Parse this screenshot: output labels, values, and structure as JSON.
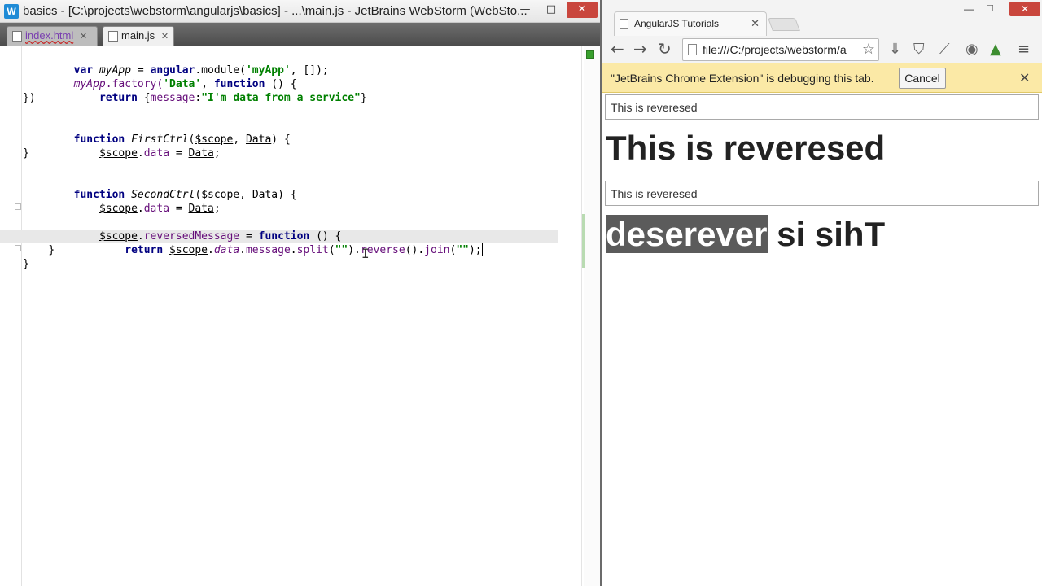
{
  "ide": {
    "title": "basics - [C:\\projects\\webstorm\\angularjs\\basics] - ...\\main.js - JetBrains WebStorm (WebSto...",
    "app_icon": "W",
    "window_controls": {
      "minimize": "—",
      "maximize": "□",
      "close": "✕"
    },
    "tabs": [
      {
        "label": "index.html",
        "close": "✕"
      },
      {
        "label": "main.js",
        "close": "✕"
      }
    ],
    "code": {
      "l1": [
        "var",
        " ",
        "myApp",
        " = ",
        "angular",
        ".module(",
        "'myApp'",
        ", []);"
      ],
      "l2": [
        "myApp",
        ".factory(",
        "'Data'",
        ", ",
        "function",
        " () {"
      ],
      "l3": [
        "    ",
        "return",
        " {",
        "message",
        ":",
        "\"I'm data from a service\"",
        "}"
      ],
      "l4": [
        "})"
      ],
      "l6": [
        "function",
        " ",
        "FirstCtrl",
        "(",
        "$scope",
        ", ",
        "Data",
        ") {"
      ],
      "l7": [
        "    ",
        "$scope",
        ".",
        "data",
        " = ",
        "Data",
        ";"
      ],
      "l8": [
        "}"
      ],
      "l10": [
        "function",
        " ",
        "SecondCtrl",
        "(",
        "$scope",
        ", ",
        "Data",
        ") {"
      ],
      "l11": [
        "    ",
        "$scope",
        ".",
        "data",
        " = ",
        "Data",
        ";"
      ],
      "l13": [
        "    ",
        "$scope",
        ".",
        "reversedMessage",
        " = ",
        "function",
        " () {"
      ],
      "l14": [
        "        ",
        "return",
        " ",
        "$scope",
        ".",
        "data",
        ".",
        "message",
        ".",
        "split",
        "(",
        "\"\"",
        ").",
        "reverse",
        "().",
        "join",
        "(",
        "\"\"",
        ");"
      ],
      "l15": [
        "    ",
        "}"
      ],
      "l16": [
        "}"
      ]
    }
  },
  "browser": {
    "tab_title": "AngularJS Tutorials",
    "tab_close": "✕",
    "window_controls": {
      "minimize": "—",
      "maximize": "□",
      "close": "✕"
    },
    "nav": {
      "back": "←",
      "forward": "→",
      "reload": "↻"
    },
    "url": "file:///C:/projects/webstorm/a",
    "star": "☆",
    "extensions": [
      "⇓",
      "⛉",
      "⟋",
      "◉",
      "▲",
      "≡"
    ],
    "infobar": {
      "text": "\"JetBrains Chrome Extension\" is debugging this tab.",
      "cancel": "Cancel",
      "close": "✕"
    },
    "page": {
      "input_1": "This is reveresed",
      "heading_1": "This is reveresed",
      "input_2": "This is reveresed",
      "heading_2_selected": "deserever",
      "heading_2_rest": " si sihT"
    }
  }
}
